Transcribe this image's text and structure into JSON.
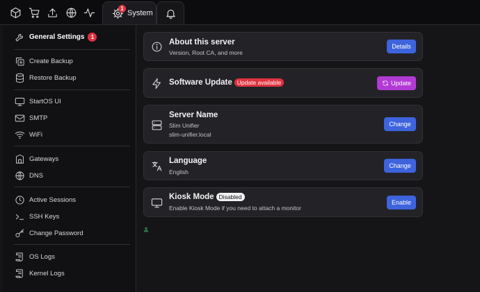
{
  "topbar": {
    "icons": [
      "box-icon",
      "cart-icon",
      "upload-icon",
      "globe-icon",
      "activity-icon"
    ],
    "tabs": [
      {
        "label": "System",
        "badge": "1",
        "icon": "gear-icon"
      },
      {
        "label": "",
        "icon": "bell-icon"
      }
    ]
  },
  "sidebar": {
    "items": [
      {
        "label": "General Settings",
        "badge": "1",
        "icon": "wrench-icon"
      },
      {
        "label": "Create Backup",
        "icon": "copy-plus-icon"
      },
      {
        "label": "Restore Backup",
        "icon": "database-icon"
      },
      {
        "label": "StartOS UI",
        "icon": "monitor-icon"
      },
      {
        "label": "SMTP",
        "icon": "mail-icon"
      },
      {
        "label": "WiFi",
        "icon": "wifi-icon"
      },
      {
        "label": "Gateways",
        "icon": "gateway-icon"
      },
      {
        "label": "DNS",
        "icon": "globe-icon"
      },
      {
        "label": "Active Sessions",
        "icon": "clock-icon"
      },
      {
        "label": "SSH Keys",
        "icon": "terminal-icon"
      },
      {
        "label": "Change Password",
        "icon": "key-icon"
      },
      {
        "label": "OS Logs",
        "icon": "scroll-icon"
      },
      {
        "label": "Kernel Logs",
        "icon": "scroll-icon"
      }
    ]
  },
  "cards": {
    "about": {
      "title": "About this server",
      "sub": "Version, Root CA, and more",
      "button": "Details"
    },
    "update": {
      "title": "Software Update",
      "badge": "Update available",
      "button": "Update"
    },
    "name": {
      "title": "Server Name",
      "sub1": "Slim Unifier",
      "sub2": "slim-unifier.local",
      "button": "Change"
    },
    "language": {
      "title": "Language",
      "sub": "English",
      "button": "Change"
    },
    "kiosk": {
      "title": "Kiosk Mode",
      "badge": "Disabled",
      "sub": "Enable Kiosk Mode if you need to attach a monitor",
      "button": "Enable"
    }
  },
  "colors": {
    "accent_blue": "#3d63dd",
    "accent_purple": "#b23ad4",
    "badge_red": "#e0323f"
  }
}
